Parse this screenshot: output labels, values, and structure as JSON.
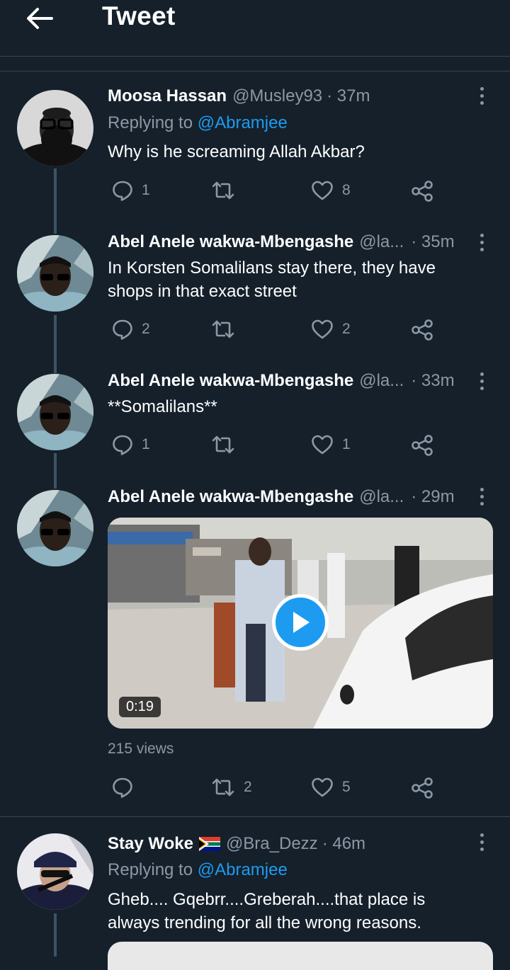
{
  "header": {
    "title": "Tweet",
    "back_icon": "arrow-left-icon"
  },
  "colors": {
    "background": "#15202b",
    "accent": "#1d9bf0",
    "muted": "#8b98a5",
    "border": "#38444d"
  },
  "tweets": [
    {
      "name": "Moosa Hassan",
      "handle": "@Musley93",
      "time": "· 37m",
      "reply_label": "Replying to",
      "reply_to": "@Abramjee",
      "text": "Why is he screaming Allah Akbar?",
      "replies": "1",
      "retweets": "",
      "likes": "8"
    },
    {
      "name": "Abel Anele wakwa-Mbengashe",
      "handle": "@la...",
      "time": "· 35m",
      "text": "In Korsten Somalilans stay there, they have shops in that exact street",
      "replies": "2",
      "retweets": "",
      "likes": "2"
    },
    {
      "name": "Abel Anele wakwa-Mbengashe",
      "handle": "@la...",
      "time": "· 33m",
      "text": "**Somalilans**",
      "replies": "1",
      "retweets": "",
      "likes": "1"
    },
    {
      "name": "Abel Anele wakwa-Mbengashe",
      "handle": "@la...",
      "time": "· 29m",
      "video_duration": "0:19",
      "views": "215 views",
      "replies": "",
      "retweets": "2",
      "likes": "5"
    },
    {
      "name": "Stay Woke",
      "flag": "south-africa-flag-icon",
      "handle": "@Bra_Dezz",
      "time": "· 46m",
      "reply_label": "Replying to",
      "reply_to": "@Abramjee",
      "text": "Gheb.... Gqebrr....Greberah....that place is always trending for all the wrong reasons."
    }
  ]
}
